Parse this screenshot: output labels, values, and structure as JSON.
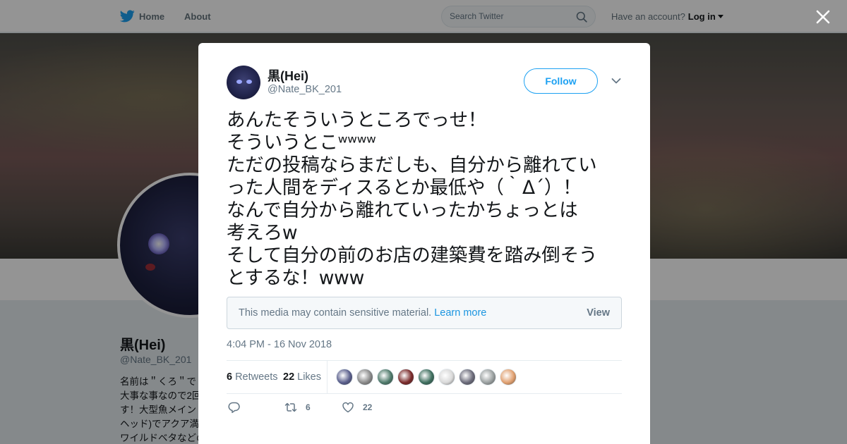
{
  "nav": {
    "home_label": "Home",
    "about_label": "About",
    "search_placeholder": "Search Twitter",
    "account_text": "Have an account?",
    "login_label": "Log in"
  },
  "profile": {
    "name": "黒(Hei)",
    "handle": "@Nate_BK_201",
    "bio_lines": [
      "名前は＂くろ＂で",
      "大事な事なので2回",
      "す！大型魚メイン",
      "ヘッド)でアクア満",
      "ワイルドベタなどの小型美魚も大好きだ"
    ]
  },
  "tweet": {
    "author_name": "黒(Hei)",
    "author_handle": "@Nate_BK_201",
    "follow_label": "Follow",
    "text_lines": [
      "あんたそういうところでっせ！",
      "そういうとこʷʷʷʷ",
      "ただの投稿ならまだしも、自分から離れてい",
      "った人間をディスるとか最低や（｀Δ´）！",
      "なんで自分から離れていったかちょっとは",
      "考えろw",
      "そして自分の前のお店の建築費を踏み倒そう",
      "とするな！www"
    ],
    "sensitive_text": "This media may contain sensitive material.",
    "learn_more_label": "Learn more",
    "view_label": "View",
    "timestamp": "4:04 PM - 16 Nov 2018",
    "retweets_count": "6",
    "retweets_label": "Retweets",
    "likes_count": "22",
    "likes_label": "Likes",
    "action_retweet_count": "6",
    "action_like_count": "22",
    "liker_colors": [
      "#5a5f8c",
      "#8a8a8a",
      "#4f7a6b",
      "#7a2b2b",
      "#3f6f5f",
      "#d9d9d9",
      "#6b6b7a",
      "#9aa0a0",
      "#e0a070"
    ]
  },
  "colors": {
    "accent": "#1da1f2",
    "link": "#1b95e0"
  }
}
